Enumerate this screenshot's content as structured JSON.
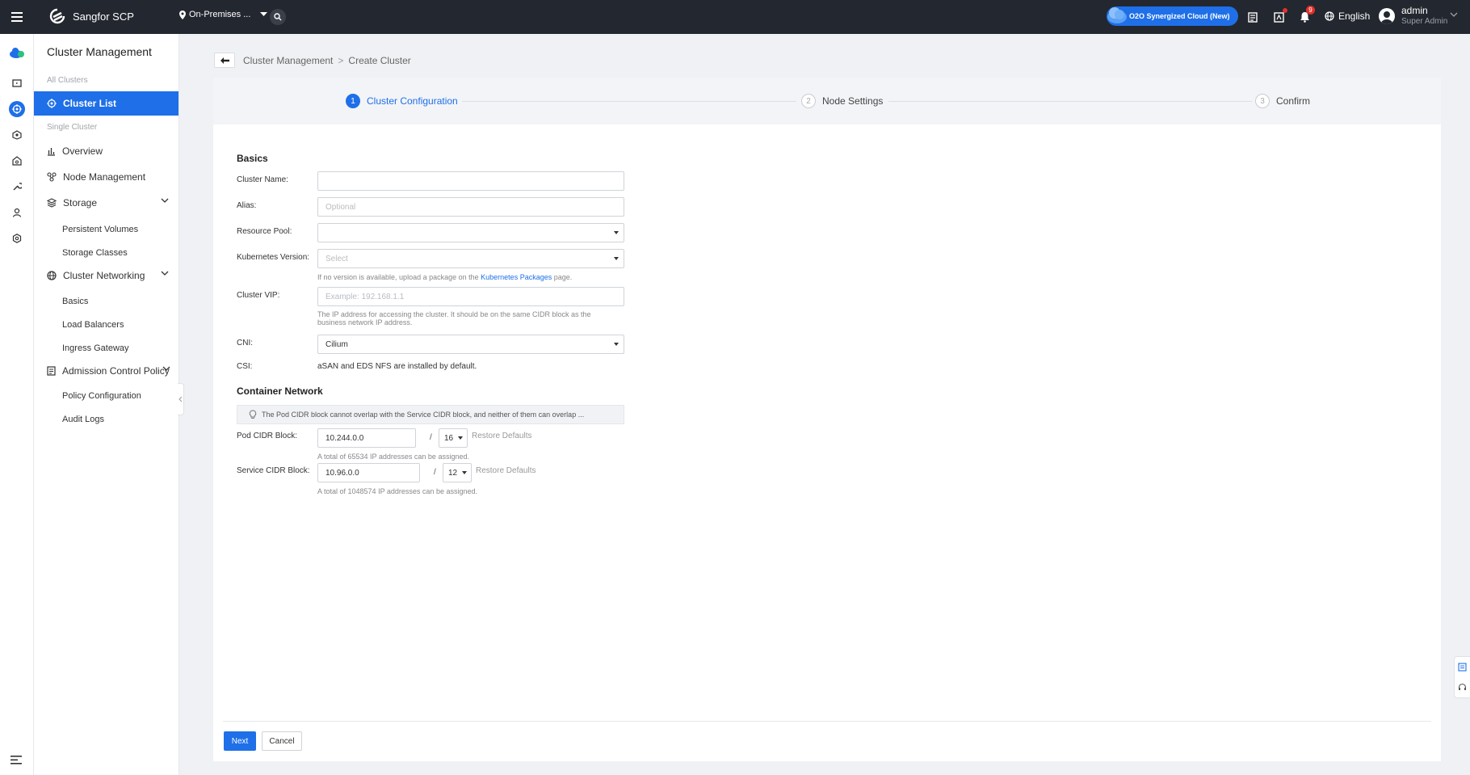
{
  "topbar": {
    "brand": "Sangfor SCP",
    "environment": "On-Premises ...",
    "o2o_label": "O2O Synergized Cloud (New)",
    "notification_count": "9",
    "language": "English",
    "user_name": "admin",
    "user_role": "Super Admin"
  },
  "sidebar": {
    "title": "Cluster Management",
    "group_all": "All Clusters",
    "cluster_list": "Cluster List",
    "group_single": "Single Cluster",
    "overview": "Overview",
    "node_management": "Node Management",
    "storage": "Storage",
    "persistent_volumes": "Persistent Volumes",
    "storage_classes": "Storage Classes",
    "cluster_networking": "Cluster Networking",
    "basics": "Basics",
    "load_balancers": "Load Balancers",
    "ingress_gateway": "Ingress Gateway",
    "admission_control_policy": "Admission Control Policy",
    "policy_configuration": "Policy Configuration",
    "audit_logs": "Audit Logs"
  },
  "breadcrumb": {
    "parent": "Cluster Management",
    "separator": ">",
    "current": "Create Cluster"
  },
  "steps": [
    {
      "num": "1",
      "label": "Cluster Configuration"
    },
    {
      "num": "2",
      "label": "Node Settings"
    },
    {
      "num": "3",
      "label": "Confirm"
    }
  ],
  "form": {
    "basics_title": "Basics",
    "cluster_name_label": "Cluster Name:",
    "cluster_name_value": "",
    "alias_label": "Alias:",
    "alias_placeholder": "Optional",
    "resource_pool_label": "Resource Pool:",
    "resource_pool_value": "",
    "k8s_version_label": "Kubernetes Version:",
    "k8s_version_placeholder": "Select",
    "k8s_hint_prefix": "If no version is available, upload a package on the",
    "k8s_hint_link": "Kubernetes Packages",
    "k8s_hint_suffix": "page.",
    "vip_label": "Cluster VIP:",
    "vip_placeholder": "Example: 192.168.1.1",
    "vip_hint_line1": "The IP address for accessing the cluster. It should be on the same CIDR block as the",
    "vip_hint_line2": "business network IP address.",
    "cni_label": "CNI:",
    "cni_value": "Cilium",
    "csi_label": "CSI:",
    "csi_value": "aSAN and EDS NFS are installed by default.",
    "container_network_title": "Container Network",
    "notice": "The Pod CIDR block cannot overlap with the Service CIDR block, and neither of them can overlap ...",
    "pod_cidr_label": "Pod CIDR Block:",
    "pod_cidr_value": "10.244.0.0",
    "pod_mask_value": "16",
    "pod_hint": "A total of 65534 IP addresses can be assigned.",
    "service_cidr_label": "Service CIDR Block:",
    "service_cidr_value": "10.96.0.0",
    "service_mask_value": "12",
    "service_hint": "A total of 1048574 IP addresses can be assigned.",
    "slash": "/",
    "restore_defaults": "Restore Defaults"
  },
  "actions": {
    "next": "Next",
    "cancel": "Cancel"
  },
  "colors": {
    "accent": "#1e6fe8",
    "topbar": "#23272f",
    "badge": "#e0322d"
  }
}
